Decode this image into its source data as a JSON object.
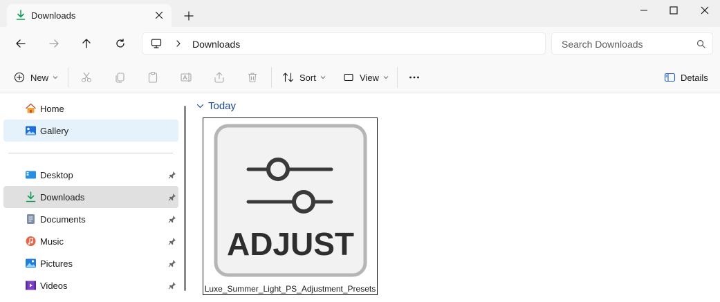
{
  "window": {
    "tab_title": "Downloads",
    "tab_icon": "download-icon",
    "accent": "#0f9d58"
  },
  "address": {
    "location": "Downloads",
    "root_icon": "this-pc-icon",
    "search_placeholder": "Search Downloads"
  },
  "toolbar": {
    "new_label": "New",
    "sort_label": "Sort",
    "view_label": "View",
    "details_label": "Details",
    "more_icon": "more-ellipsis-icon"
  },
  "sidebar": {
    "quick": [
      {
        "label": "Home",
        "icon": "home-icon"
      },
      {
        "label": "Gallery",
        "icon": "gallery-icon"
      }
    ],
    "pinned": [
      {
        "label": "Desktop",
        "icon": "desktop-folder-icon"
      },
      {
        "label": "Downloads",
        "icon": "download-icon"
      },
      {
        "label": "Documents",
        "icon": "documents-folder-icon"
      },
      {
        "label": "Music",
        "icon": "music-folder-icon"
      },
      {
        "label": "Pictures",
        "icon": "pictures-folder-icon"
      },
      {
        "label": "Videos",
        "icon": "videos-folder-icon"
      }
    ]
  },
  "content": {
    "group_title": "Today",
    "files": [
      {
        "name": "Luxe_Summer_Light_PS_Adjustment_Presets",
        "thumbnail_text": "ADJUST",
        "thumbnail_icon": "adjustment-sliders-icon"
      }
    ]
  }
}
